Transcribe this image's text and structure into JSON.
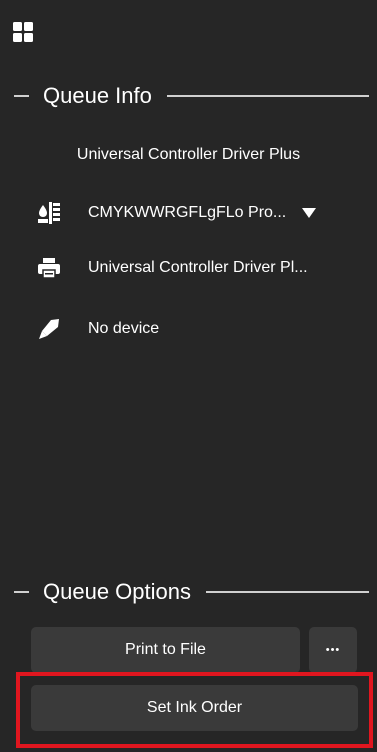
{
  "queue_info": {
    "header": "Queue Info",
    "driver_title": "Universal Controller Driver Plus",
    "ink_profile": "CMYKWWRGFLgFLo Pro...",
    "printer_name": "Universal Controller Driver Pl...",
    "device_status": "No device"
  },
  "queue_options": {
    "header": "Queue Options",
    "print_to_file_label": "Print to File",
    "more_label": "•••",
    "set_ink_order_label": "Set Ink Order"
  },
  "icons": {
    "top": "grid-icon",
    "ink_profile": "ink-channels-icon",
    "printer": "printer-icon",
    "device": "pen-nib-icon",
    "dropdown": "chevron-down-icon"
  },
  "colors": {
    "background": "#262626",
    "button": "#3a3a3a",
    "highlight": "#e0161f",
    "text": "#ffffff"
  }
}
